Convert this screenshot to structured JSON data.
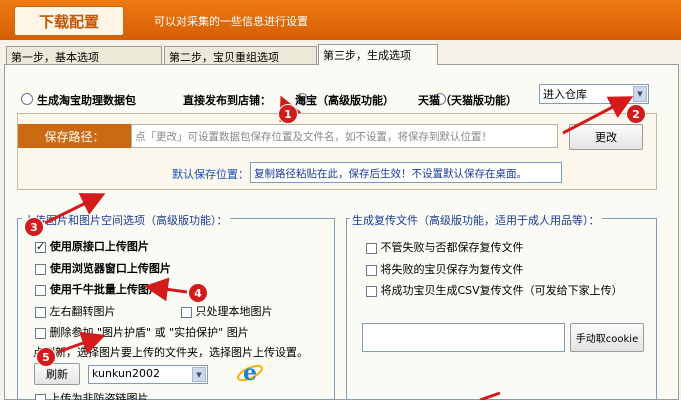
{
  "header": {
    "title": "下载配置",
    "description": "可以对采集的一些信息进行设置"
  },
  "tabs": [
    {
      "label": "第一步，基本选项"
    },
    {
      "label": "第二步，宝贝重组选项"
    },
    {
      "label": "第三步，生成选项"
    }
  ],
  "options_row": {
    "generate_label": "生成淘宝助理数据包",
    "publish_label": "直接发布到店铺：",
    "taobao_label": "淘宝（高级版功能）",
    "tmall_label": "天猫（天猫版功能）",
    "warehouse_select": "进入仓库"
  },
  "save_path": {
    "label": "保存路径：",
    "placeholder": "点「更改」可设置数据包保存位置及文件名，如不设置，将保存到默认位置！",
    "change_button": "更改",
    "default_label": "默认保存位置：",
    "default_value": "复制路径粘贴在此，保存后生效！不设置默认保存在桌面。"
  },
  "image_group": {
    "title": "上传图片和图片空间选项（高级版功能）：",
    "options": [
      {
        "label": "使用原接口上传图片",
        "checked": true
      },
      {
        "label": "使用浏览器窗口上传图片",
        "checked": false
      },
      {
        "label": "使用千牛批量上传图片",
        "checked": false
      },
      {
        "label": "左右翻转图片",
        "checked": false
      },
      {
        "label": "只处理本地图片",
        "checked": false
      },
      {
        "label": "删除参加 \"图片护盾\" 或 \"实拍保护\" 图片",
        "checked": false
      },
      {
        "label": "上传为非防盗链图片",
        "checked": false
      }
    ],
    "folder_hint": "点刷新，选择图片要上传的文件夹，选择图片上传设置。",
    "refresh_button": "刷新",
    "account_select": "kunkun2002"
  },
  "resend_group": {
    "title": "生成复传文件（高级版功能，适用于成人用品等）：",
    "options": [
      {
        "label": "不管失败与否都保存复传文件",
        "checked": false
      },
      {
        "label": "将失败的宝贝保存为复传文件",
        "checked": false
      },
      {
        "label": "将成功宝贝生成CSV复传文件（可发给下家上传）",
        "checked": false
      }
    ],
    "cookie_button": "手动取cookie"
  },
  "markers": [
    "1",
    "2",
    "3",
    "4",
    "5"
  ],
  "colors": {
    "header": "#e06a0a",
    "accent_label": "#cc6a13",
    "marker": "#d41b1b"
  }
}
